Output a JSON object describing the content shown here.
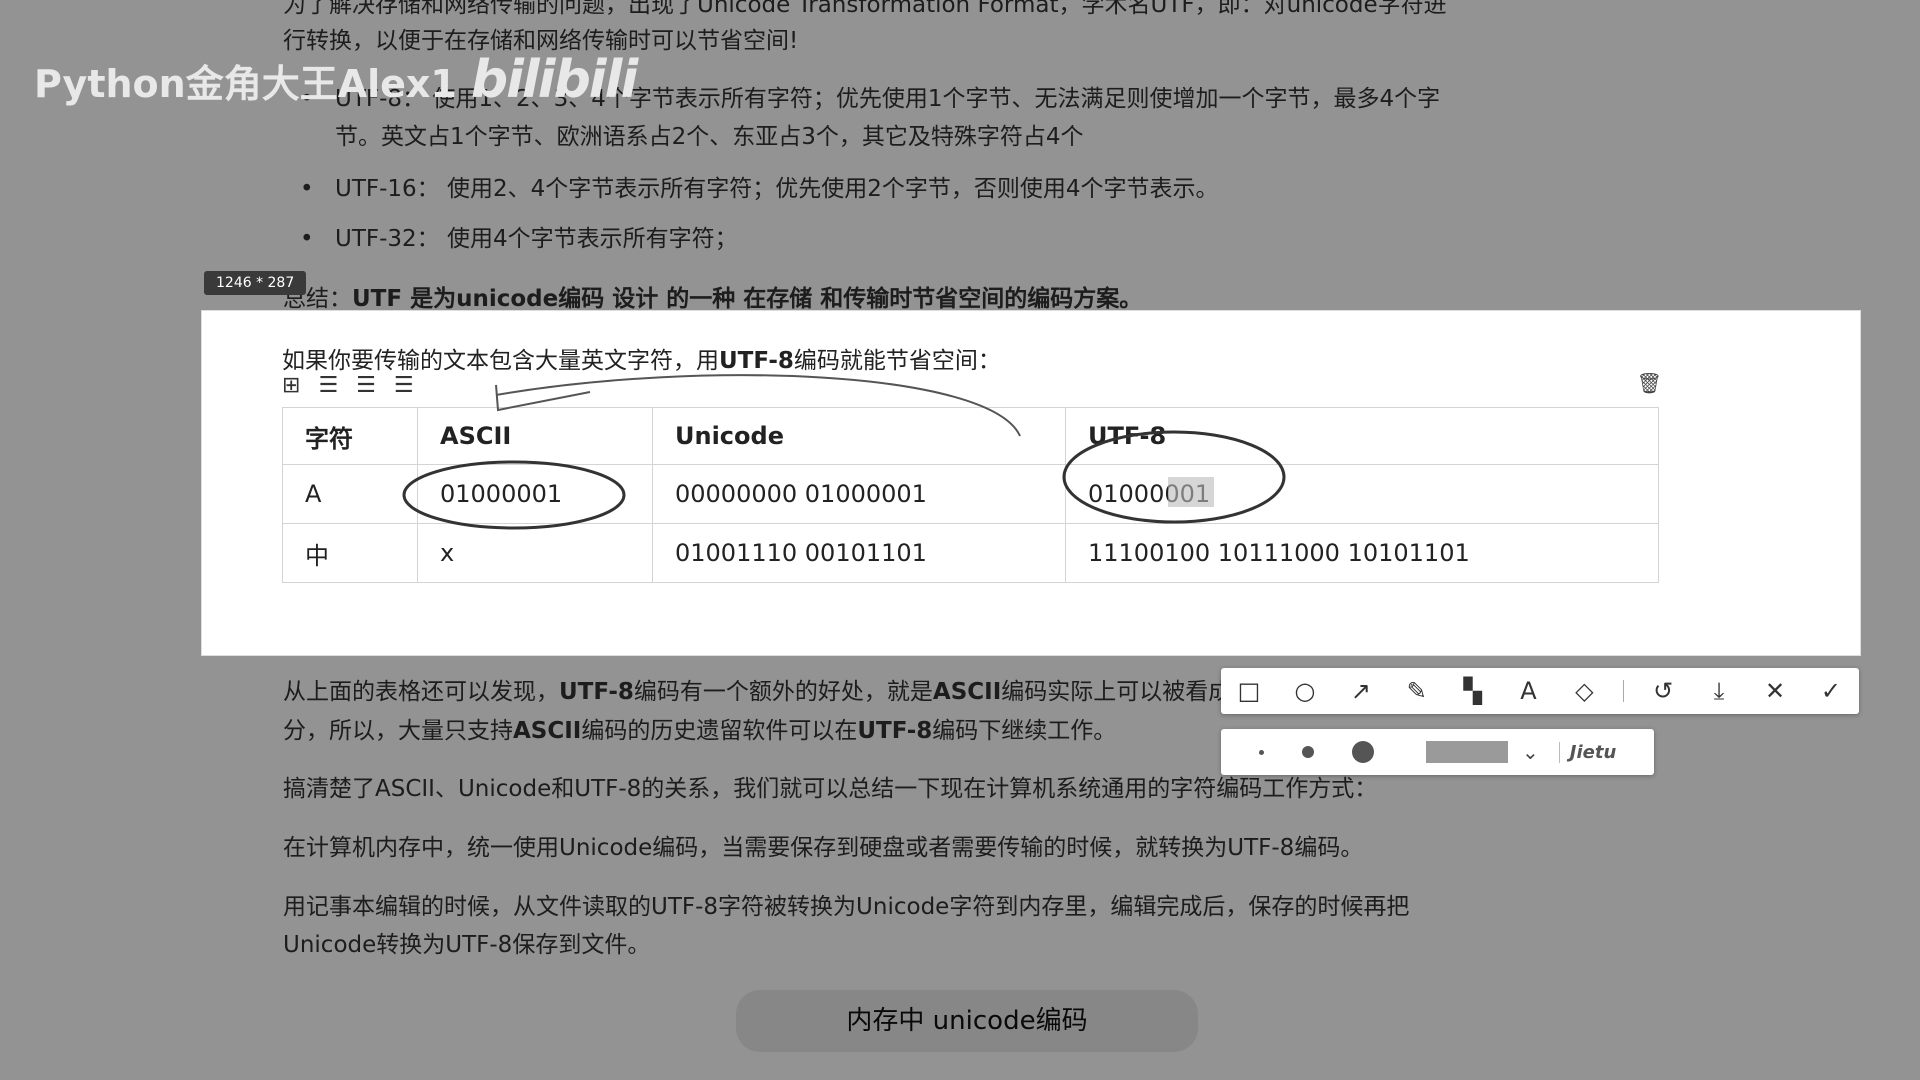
{
  "watermark": {
    "channel": "Python金角大王Alex1",
    "logo": "bilibili"
  },
  "doc": {
    "intro_line1": "为了解决存储和网络传输的问题，出现了Unicode Transformation Format，学术名UTF，即：对unicode字符进",
    "intro_line2": "行转换，以便于在存储和网络传输时可以节省空间!",
    "bullets": [
      {
        "line1": "UTF-8：  使用1、2、3、4个字节表示所有字符；优先使用1个字节、无法满足则使增加一个字节，最多4个字",
        "line2": "节。英文占1个字节、欧洲语系占2个、东亚占3个，其它及特殊字符占4个"
      },
      {
        "line1": "UTF-16：  使用2、4个字节表示所有字符；优先使用2个字节，否则使用4个字节表示。",
        "line2": ""
      },
      {
        "line1": "UTF-32：  使用4个字节表示所有字符；",
        "line2": ""
      }
    ],
    "summary_prefix": "总结：",
    "summary_bold": "UTF 是为unicode编码 设计 的一种 在存储 和传输时节省空间的编码方案。",
    "para_after_1a": "从上面的表格还可以发现，",
    "para_after_1b": "UTF-8",
    "para_after_1c": "编码有一个额外的好处，就是",
    "para_after_1d": "ASCII",
    "para_after_1e": "编码实际上可以被看成是",
    "para_after_2a": "分，所以，大量只支持",
    "para_after_2b": "ASCII",
    "para_after_2c": "编码的历史遗留软件可以在",
    "para_after_2d": "UTF-8",
    "para_after_2e": "编码下继续工作。",
    "para3": "搞清楚了ASCII、Unicode和UTF-8的关系，我们就可以总结一下现在计算机系统通用的字符编码工作方式：",
    "para4": "在计算机内存中，统一使用Unicode编码，当需要保存到硬盘或者需要传输的时候，就转换为UTF-8编码。",
    "para5_line1": "用记事本编辑的时候，从文件读取的UTF-8字符被转换为Unicode字符到内存里，编辑完成后，保存的时候再把",
    "para5_line2": "Unicode转换为UTF-8保存到文件。",
    "flow_box": "内存中 unicode编码"
  },
  "capture": {
    "size_label": "1246 * 287",
    "sentence_a": "如果你要传输的文本包含大量英文字符，用",
    "sentence_b": "UTF-8",
    "sentence_c": "编码就能节省空间：",
    "table": {
      "headers": [
        "字符",
        "ASCII",
        "Unicode",
        "UTF-8"
      ],
      "rows": [
        [
          "A",
          "01000001",
          "00000000 01000001",
          "01000001"
        ],
        [
          "中",
          "x",
          "01001110 00101101",
          "11100100 10111000 10101101"
        ]
      ]
    }
  },
  "toolbar": {
    "tools": [
      "rectangle-tool",
      "ellipse-tool",
      "arrow-tool",
      "pen-tool",
      "mosaic-tool",
      "text-tool",
      "eraser-tool",
      "undo",
      "download",
      "close",
      "confirm"
    ],
    "brand": "Jietu"
  }
}
